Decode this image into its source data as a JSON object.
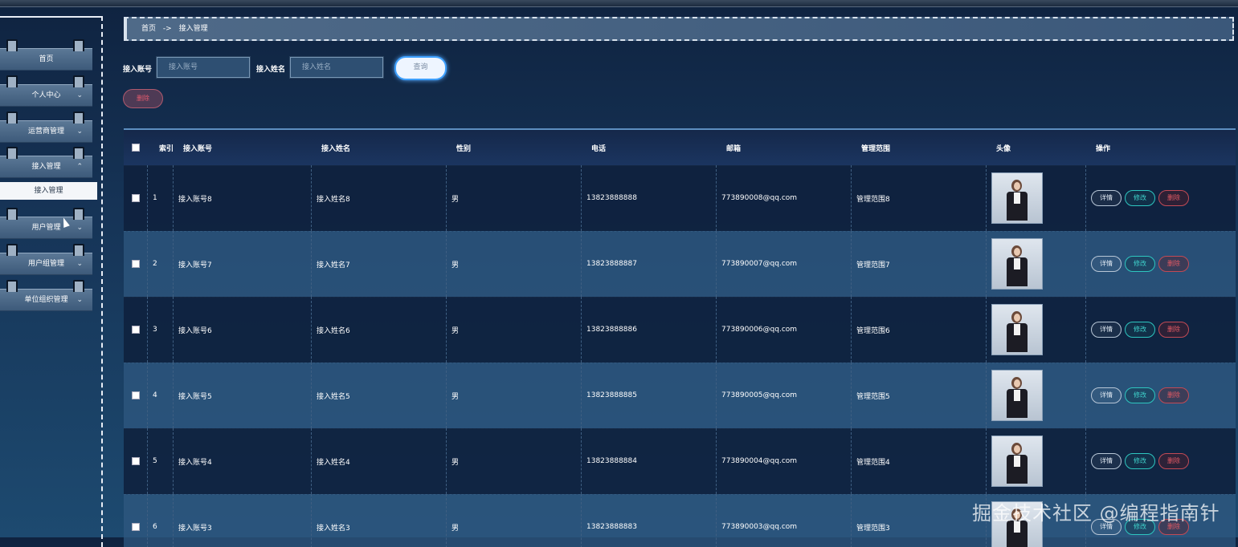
{
  "sidebar": {
    "items": [
      {
        "label": "首页",
        "chevron": ""
      },
      {
        "label": "个人中心",
        "chevron": "⌄"
      },
      {
        "label": "运营商管理",
        "chevron": "⌄"
      },
      {
        "label": "接入管理",
        "chevron": "⌃"
      },
      {
        "label": "用户管理",
        "chevron": "⌄"
      },
      {
        "label": "用户组管理",
        "chevron": "⌄"
      },
      {
        "label": "单位组织管理",
        "chevron": "⌄"
      }
    ],
    "active_submenu": "接入管理"
  },
  "breadcrumb": {
    "home": "首页",
    "sep": "->",
    "current": "接入管理"
  },
  "search": {
    "account_label": "接入账号",
    "account_placeholder": "接入账号",
    "name_label": "接入姓名",
    "name_placeholder": "接入姓名",
    "query_label": "查询",
    "delete_label": "删除"
  },
  "table": {
    "headers": {
      "index": "索引",
      "account": "接入账号",
      "name": "接入姓名",
      "gender": "性别",
      "phone": "电话",
      "email": "邮箱",
      "scope": "管理范围",
      "avatar": "头像",
      "ops": "操作"
    },
    "rows": [
      {
        "index": "1",
        "account": "接入账号8",
        "name": "接入姓名8",
        "gender": "男",
        "phone": "13823888888",
        "email": "773890008@qq.com",
        "scope": "管理范围8"
      },
      {
        "index": "2",
        "account": "接入账号7",
        "name": "接入姓名7",
        "gender": "男",
        "phone": "13823888887",
        "email": "773890007@qq.com",
        "scope": "管理范围7"
      },
      {
        "index": "3",
        "account": "接入账号6",
        "name": "接入姓名6",
        "gender": "男",
        "phone": "13823888886",
        "email": "773890006@qq.com",
        "scope": "管理范围6"
      },
      {
        "index": "4",
        "account": "接入账号5",
        "name": "接入姓名5",
        "gender": "男",
        "phone": "13823888885",
        "email": "773890005@qq.com",
        "scope": "管理范围5"
      },
      {
        "index": "5",
        "account": "接入账号4",
        "name": "接入姓名4",
        "gender": "男",
        "phone": "13823888884",
        "email": "773890004@qq.com",
        "scope": "管理范围4"
      },
      {
        "index": "6",
        "account": "接入账号3",
        "name": "接入姓名3",
        "gender": "男",
        "phone": "13823888883",
        "email": "773890003@qq.com",
        "scope": "管理范围3"
      }
    ],
    "ops": {
      "detail": "详情",
      "edit": "修改",
      "delete": "删除"
    }
  },
  "watermark": "掘金技术社区 @编程指南针"
}
